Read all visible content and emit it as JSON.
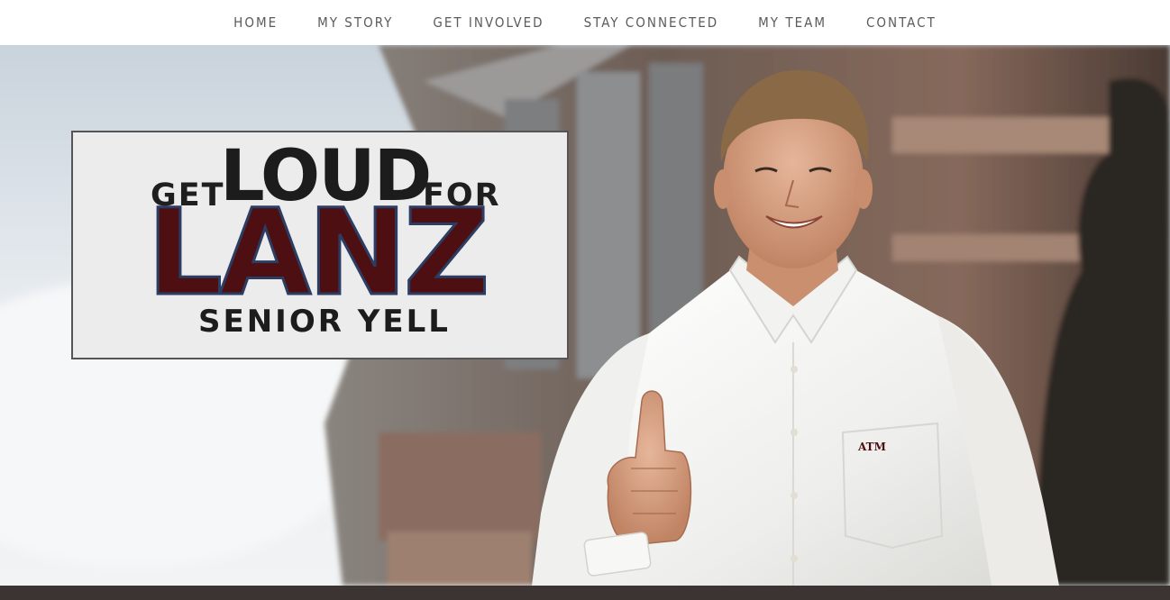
{
  "nav": {
    "items": [
      {
        "label": "HOME"
      },
      {
        "label": "MY STORY"
      },
      {
        "label": "GET INVOLVED"
      },
      {
        "label": "STAY CONNECTED"
      },
      {
        "label": "MY TEAM"
      },
      {
        "label": "CONTACT"
      }
    ]
  },
  "hero": {
    "logo": {
      "get": "GET",
      "loud": "LOUD",
      "for": "FOR",
      "lanz": "LANZ",
      "tagline": "SENIOR YELL"
    },
    "colors": {
      "maroon": "#4d0f12",
      "navy_outline": "#2c3d63",
      "shirt": "#f4f4f2",
      "sky": "#e8ecf0",
      "brick": "#7a5a4e"
    },
    "shirt_emblem": "ATM"
  }
}
